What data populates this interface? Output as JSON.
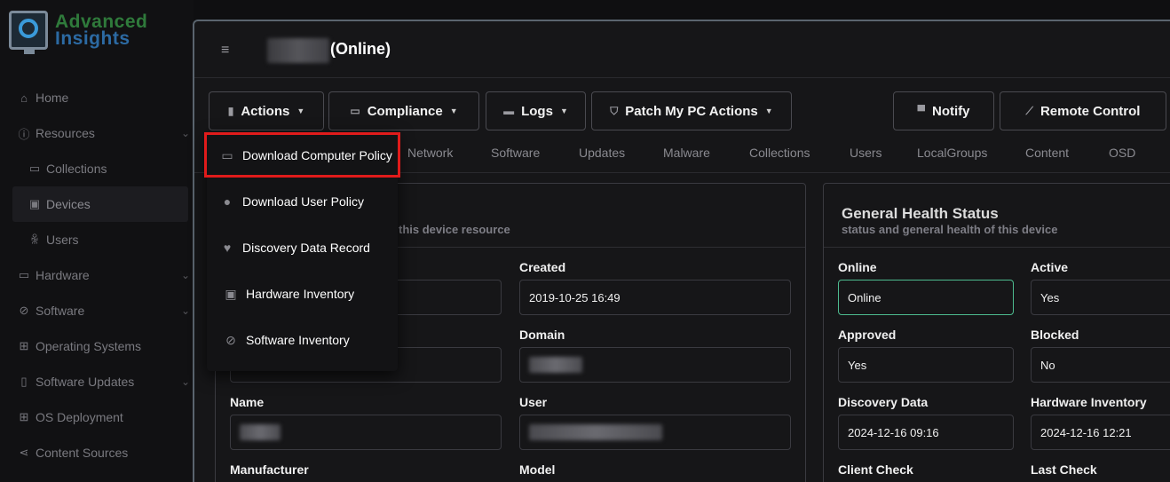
{
  "app": {
    "logo_line1": "Advanced",
    "logo_line2": "Insights"
  },
  "sidebar": {
    "items": [
      {
        "label": "Home",
        "icon": "home-icon"
      },
      {
        "label": "Resources",
        "icon": "info-icon"
      },
      {
        "label": "Collections",
        "icon": "folder-icon"
      },
      {
        "label": "Devices",
        "icon": "devices-icon"
      },
      {
        "label": "Users",
        "icon": "users-icon"
      },
      {
        "label": "Hardware",
        "icon": "hardware-icon"
      },
      {
        "label": "Software",
        "icon": "software-icon"
      },
      {
        "label": "Operating Systems",
        "icon": "windows-icon"
      },
      {
        "label": "Software Updates",
        "icon": "updates-icon"
      },
      {
        "label": "OS Deployment",
        "icon": "windows-icon"
      },
      {
        "label": "Content Sources",
        "icon": "share-icon"
      }
    ]
  },
  "header": {
    "device_status": "(Online)"
  },
  "toolbar": {
    "actions": "Actions",
    "compliance": "Compliance",
    "logs": "Logs",
    "patch": "Patch My PC Actions",
    "notify": "Notify",
    "remote": "Remote Control"
  },
  "tabs": [
    "Network",
    "Software",
    "Updates",
    "Malware",
    "Collections",
    "Users",
    "LocalGroups",
    "Content",
    "OSD"
  ],
  "actions_menu": {
    "items": [
      {
        "label": "Download Computer Policy",
        "icon": "monitor-icon"
      },
      {
        "label": "Download User Policy",
        "icon": "user-icon"
      },
      {
        "label": "Discovery Data Record",
        "icon": "heart-icon"
      },
      {
        "label": "Hardware Inventory",
        "icon": "chip-icon"
      },
      {
        "label": "Software Inventory",
        "icon": "disc-icon"
      }
    ]
  },
  "device_card": {
    "subtitle_partial": "this device resource",
    "fields": {
      "created_label": "Created",
      "created_value": "2019-10-25 16:49",
      "domain_label": "Domain",
      "name_label": "Name",
      "user_label": "User",
      "manufacturer_label": "Manufacturer",
      "model_label": "Model"
    }
  },
  "health_card": {
    "title": "General Health Status",
    "subtitle": "status and general health of this device",
    "fields": {
      "online_label": "Online",
      "online_value": "Online",
      "active_label": "Active",
      "active_value": "Yes",
      "approved_label": "Approved",
      "approved_value": "Yes",
      "blocked_label": "Blocked",
      "blocked_value": "No",
      "discovery_label": "Discovery Data",
      "discovery_value": "2024-12-16 09:16",
      "hwinv_label": "Hardware Inventory",
      "hwinv_value": "2024-12-16 12:21",
      "clientcheck_label": "Client Check",
      "lastcheck_label": "Last Check"
    }
  }
}
